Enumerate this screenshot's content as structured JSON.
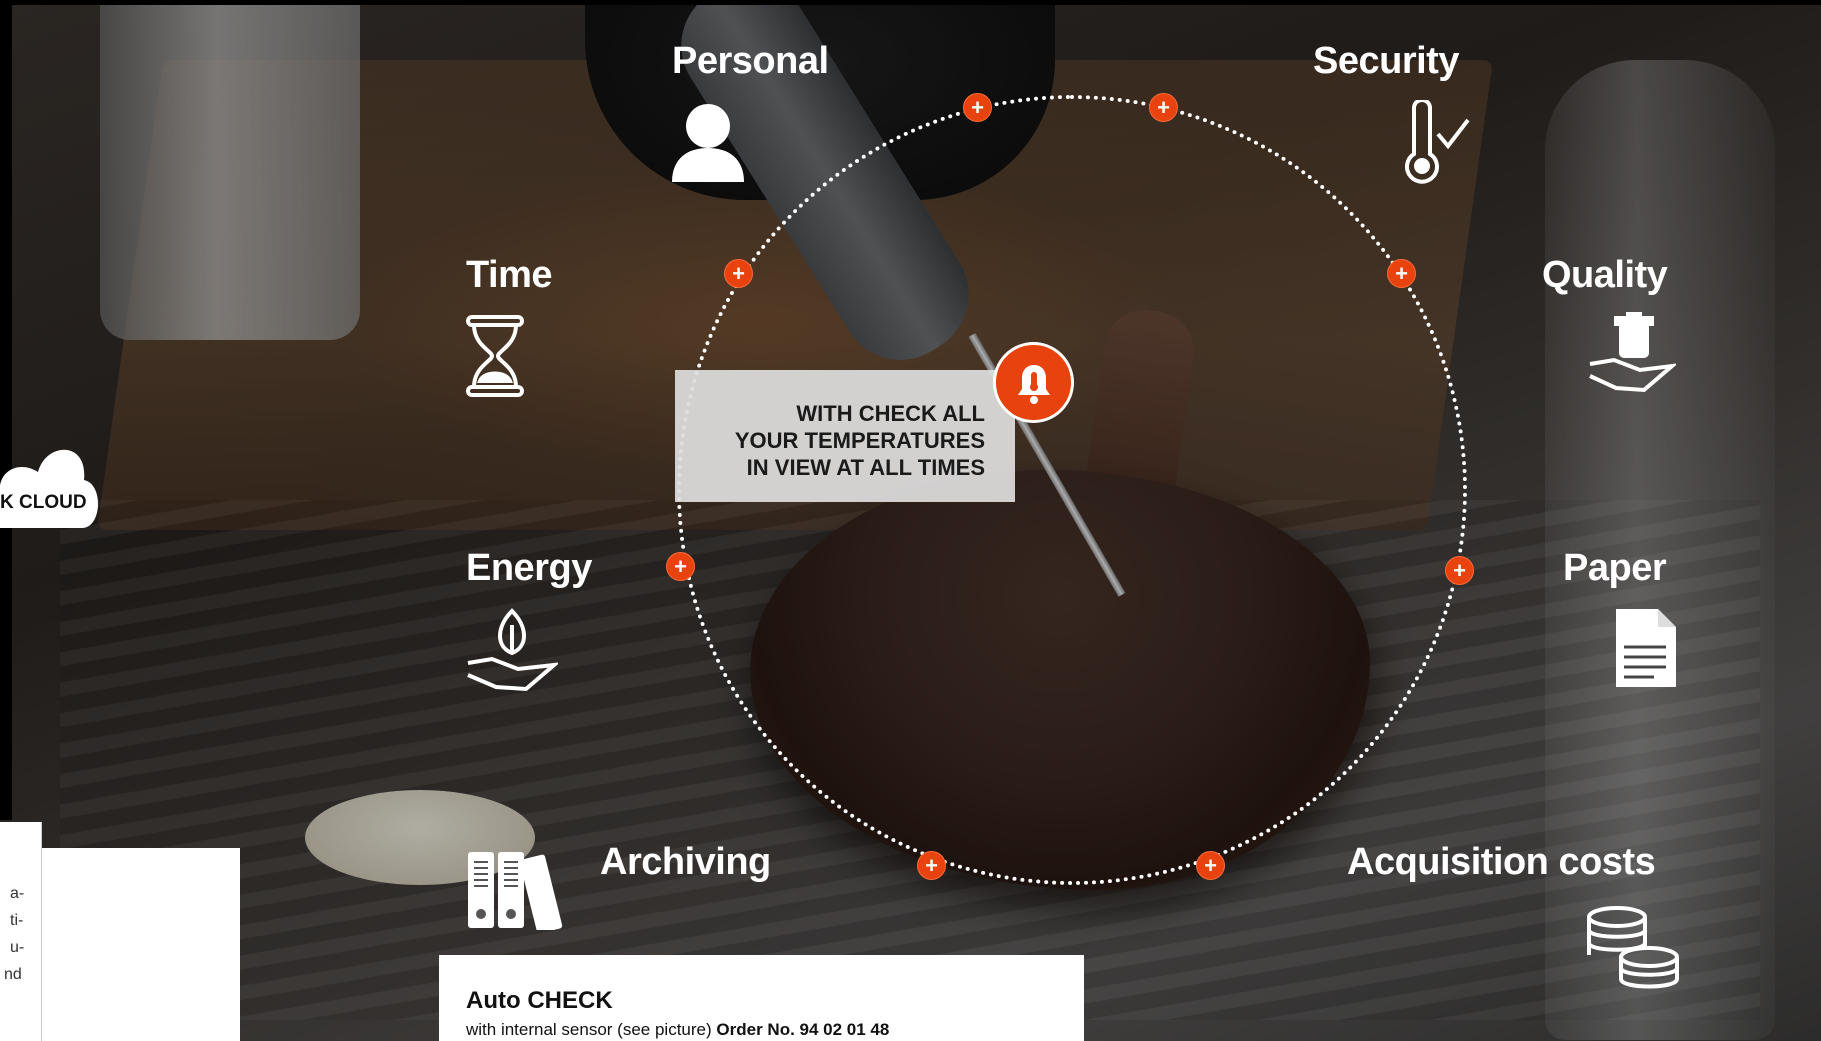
{
  "background_photo": "steak-with-thermometer-probe",
  "colors": {
    "accent": "#e8430e",
    "text": "#ffffff"
  },
  "features": {
    "personal": "Personal",
    "security": "Security",
    "time": "Time",
    "quality": "Quality",
    "energy": "Energy",
    "paper": "Paper",
    "archiving": "Archiving",
    "acquisition": "Acquisition costs"
  },
  "center_box": {
    "line1": "WITH CHECK ALL",
    "line2": "YOUR TEMPERATURES",
    "line3": "IN VIEW AT ALL TIMES",
    "icon": "bell-thermometer-icon"
  },
  "plus_label": "+",
  "cloud": {
    "label": "K CLOUD",
    "icon": "cloud-icon"
  },
  "side_text": [
    "a-",
    "ti-",
    "u-",
    "nd"
  ],
  "product": {
    "name": "Auto CHECK",
    "description": "with internal sensor (see picture)",
    "order_label": "Order No. 94 02 01 48"
  }
}
